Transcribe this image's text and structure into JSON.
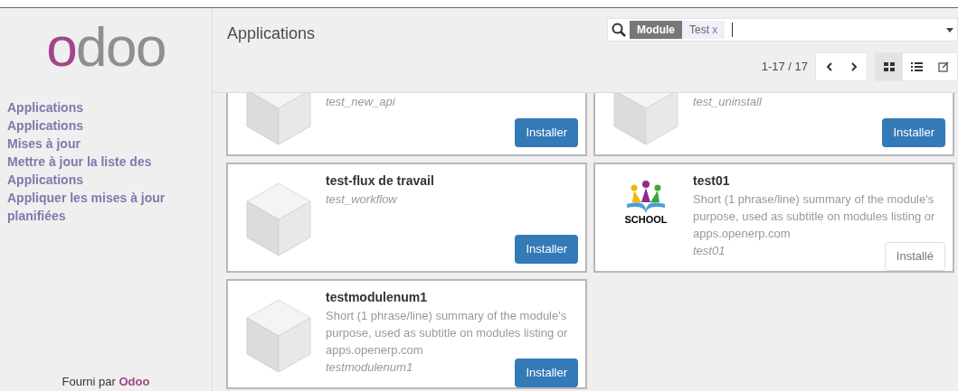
{
  "sidebar": {
    "logo": {
      "accent": "o",
      "rest": "doo"
    },
    "menu": [
      "Applications",
      "Applications",
      "Mises à jour",
      "Mettre à jour la liste des Applications",
      "Appliquer les mises à jour planifiées"
    ],
    "footer": {
      "text": "Fourni par",
      "brand": "Odoo"
    }
  },
  "header": {
    "title": "Applications",
    "search": {
      "facet_label": "Module",
      "facet_value": "Test",
      "facet_remove": "x"
    },
    "pager": "1-17 / 17",
    "views": [
      {
        "kind": "kanban",
        "selected": true
      },
      {
        "kind": "list",
        "selected": false
      },
      {
        "kind": "form",
        "selected": false
      }
    ]
  },
  "cards": [
    {
      "kind": "cube",
      "cut": true,
      "technical_name": "test_new_api",
      "button": "Installer",
      "installed": false
    },
    {
      "kind": "cube",
      "cut": true,
      "technical_name": "test_uninstall",
      "button": "Installer",
      "installed": false
    },
    {
      "kind": "cube",
      "cut": false,
      "title": "test-flux de travail",
      "technical_name": "test_workflow",
      "button": "Installer",
      "installed": false
    },
    {
      "kind": "school",
      "icon_label": "SCHOOL",
      "cut": false,
      "title": "test01",
      "summary": "Short (1 phrase/line) summary of the module's purpose, used as subtitle on modules listing or apps.openerp.com",
      "technical_name": "test01",
      "button": "Installé",
      "installed": true
    },
    {
      "kind": "cube",
      "cut": false,
      "title": "testmodulenum1",
      "summary": "Short (1 phrase/line) summary of the module's purpose, used as subtitle on modules listing or apps.openerp.com",
      "technical_name": "testmodulenum1",
      "button": "Installer",
      "installed": false
    }
  ]
}
